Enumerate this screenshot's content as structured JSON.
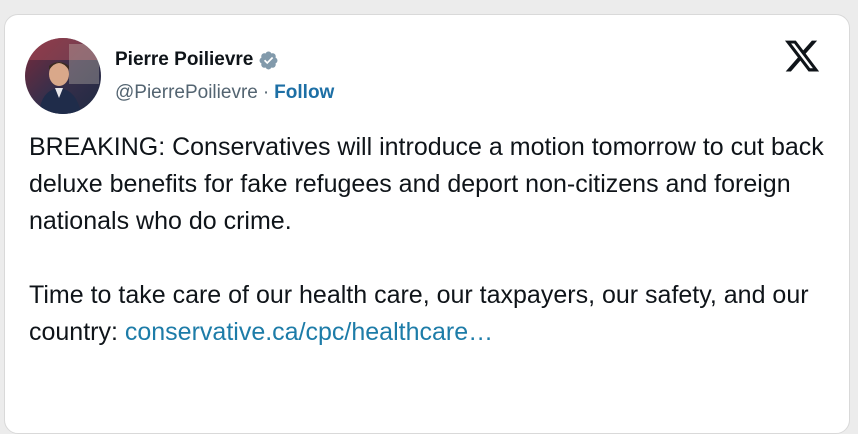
{
  "author": {
    "display_name": "Pierre Poilievre",
    "handle": "@PierrePoilievre",
    "separator": "·",
    "follow_label": "Follow"
  },
  "icons": {
    "verified": "verified-badge-icon",
    "platform": "x-logo-icon"
  },
  "tweet": {
    "paragraph_1": "BREAKING: Conservatives will introduce a motion tomorrow to cut back deluxe benefits for fake refugees and deport non-citizens and foreign nationals who do crime.",
    "paragraph_2_text": "Time to take care of our health care, our taxpayers, our safety, and our country: ",
    "paragraph_2_link": "conservative.ca/cpc/healthcare…"
  },
  "colors": {
    "text": "#0f1419",
    "muted": "#536471",
    "link": "#1d7ca8",
    "follow": "#1d6fa5",
    "verified_badge": "#829aab"
  }
}
